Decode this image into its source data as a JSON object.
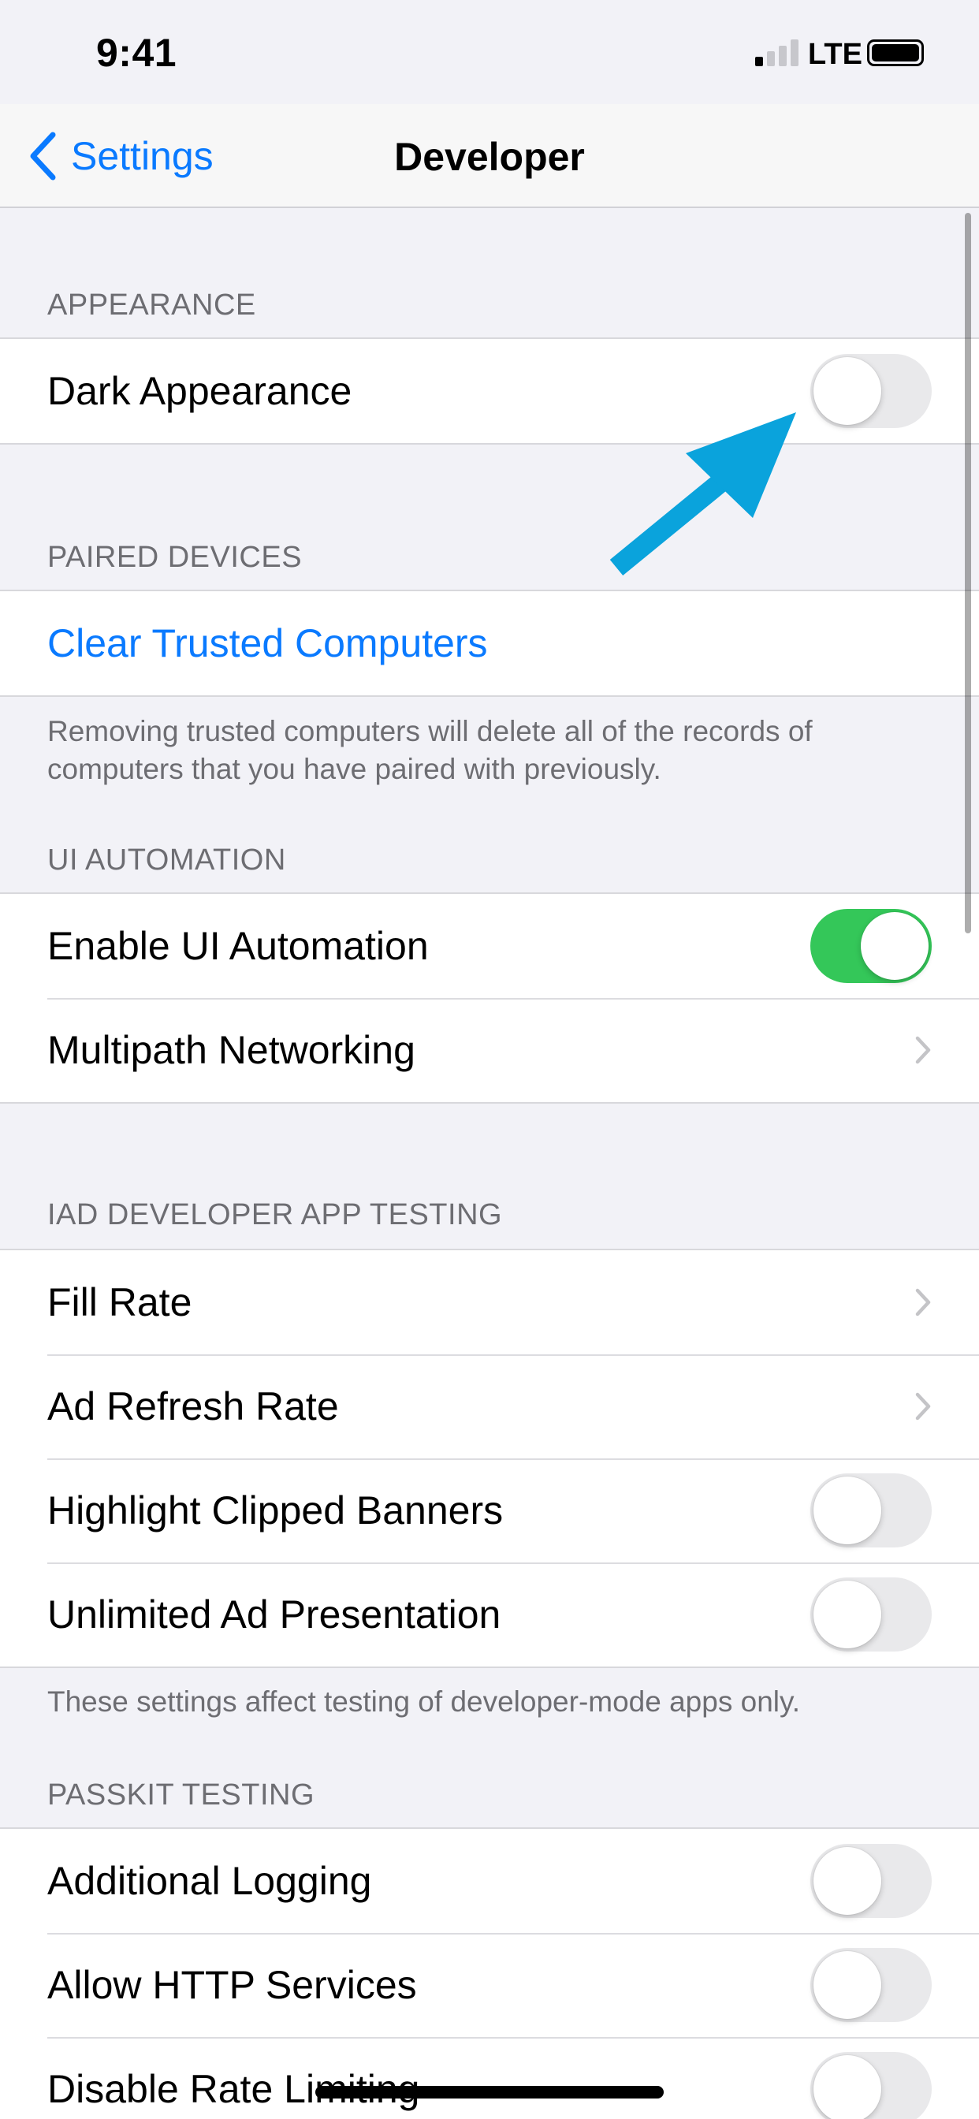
{
  "status_bar": {
    "time": "9:41",
    "network": "LTE",
    "signal_bars_active": 1,
    "signal_bars_total": 4
  },
  "nav": {
    "back_label": "Settings",
    "title": "Developer",
    "back_icon": "chevron-left-icon"
  },
  "sections": {
    "appearance": {
      "header": "APPEARANCE",
      "dark_appearance": {
        "label": "Dark Appearance",
        "on": false
      }
    },
    "paired_devices": {
      "header": "PAIRED DEVICES",
      "clear_trusted": {
        "label": "Clear Trusted Computers"
      },
      "footer": "Removing trusted computers will delete all of the records of computers that you have paired with previously."
    },
    "ui_automation": {
      "header": "UI AUTOMATION",
      "enable_ui_automation": {
        "label": "Enable UI Automation",
        "on": true
      },
      "multipath": {
        "label": "Multipath Networking"
      }
    },
    "iad": {
      "header": "IAD DEVELOPER APP TESTING",
      "fill_rate": {
        "label": "Fill Rate"
      },
      "ad_refresh_rate": {
        "label": "Ad Refresh Rate"
      },
      "highlight_clipped": {
        "label": "Highlight Clipped Banners",
        "on": false
      },
      "unlimited_ad": {
        "label": "Unlimited Ad Presentation",
        "on": false
      },
      "footer": "These settings affect testing of developer-mode apps only."
    },
    "passkit": {
      "header": "PASSKIT TESTING",
      "additional_logging": {
        "label": "Additional Logging",
        "on": false
      },
      "allow_http": {
        "label": "Allow HTTP Services",
        "on": false
      },
      "disable_rate_limiting": {
        "label": "Disable Rate Limiting",
        "on": false
      }
    }
  },
  "colors": {
    "accent": "#0a7aff",
    "toggle_on": "#34c759",
    "toggle_off": "#e9e9eb",
    "background": "#f2f2f7",
    "annotation_arrow": "#0aa3dc"
  },
  "annotation": {
    "icon": "arrow-pointer-icon",
    "target": "dark-appearance-toggle"
  }
}
